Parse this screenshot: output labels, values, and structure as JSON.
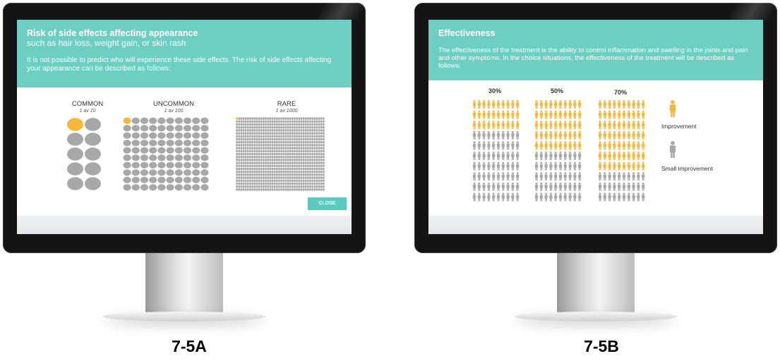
{
  "left_screen": {
    "title": "Risk of side effects affecting appearance",
    "subtitle": "such as hair loss, weight gain, or skin rash",
    "body": "It is not possible to predict who will experience these side effects. The risk of side effects affecting your appearance can be described as follows:",
    "columns": [
      {
        "label": "COMMON",
        "ratio": "1 av 10",
        "total": 10,
        "highlighted": 1
      },
      {
        "label": "UNCOMMON",
        "ratio": "1 av 100",
        "total": 100,
        "highlighted": 1
      },
      {
        "label": "RARE",
        "ratio": "1 av 1000",
        "total": 1000,
        "highlighted": 1
      }
    ],
    "close_label": "CLOSE"
  },
  "right_screen": {
    "title": "Effectiveness",
    "body": "The effectiveness of the treatment is the ability to control inflammation and swelling in the joints and pain and other symptoms. In the choice situations, the effectiveness of the treatment will be described as follows:",
    "groups": [
      {
        "label": "30%",
        "improved_fraction": 0.3
      },
      {
        "label": "50%",
        "improved_fraction": 0.5
      },
      {
        "label": "70%",
        "improved_fraction": 0.7
      }
    ],
    "legend": [
      {
        "label": "Improvement",
        "icon": "person-icon",
        "color": "#f6b83a"
      },
      {
        "label": "Small improvement",
        "icon": "person-icon",
        "color": "#a8a8a8"
      }
    ]
  },
  "colors": {
    "accent": "#6ccfc2",
    "highlight": "#f6b83a",
    "neutral": "#a8a8a8",
    "button": "#5ccbbd"
  },
  "captions": {
    "left": "7-5A",
    "right": "7-5B"
  }
}
